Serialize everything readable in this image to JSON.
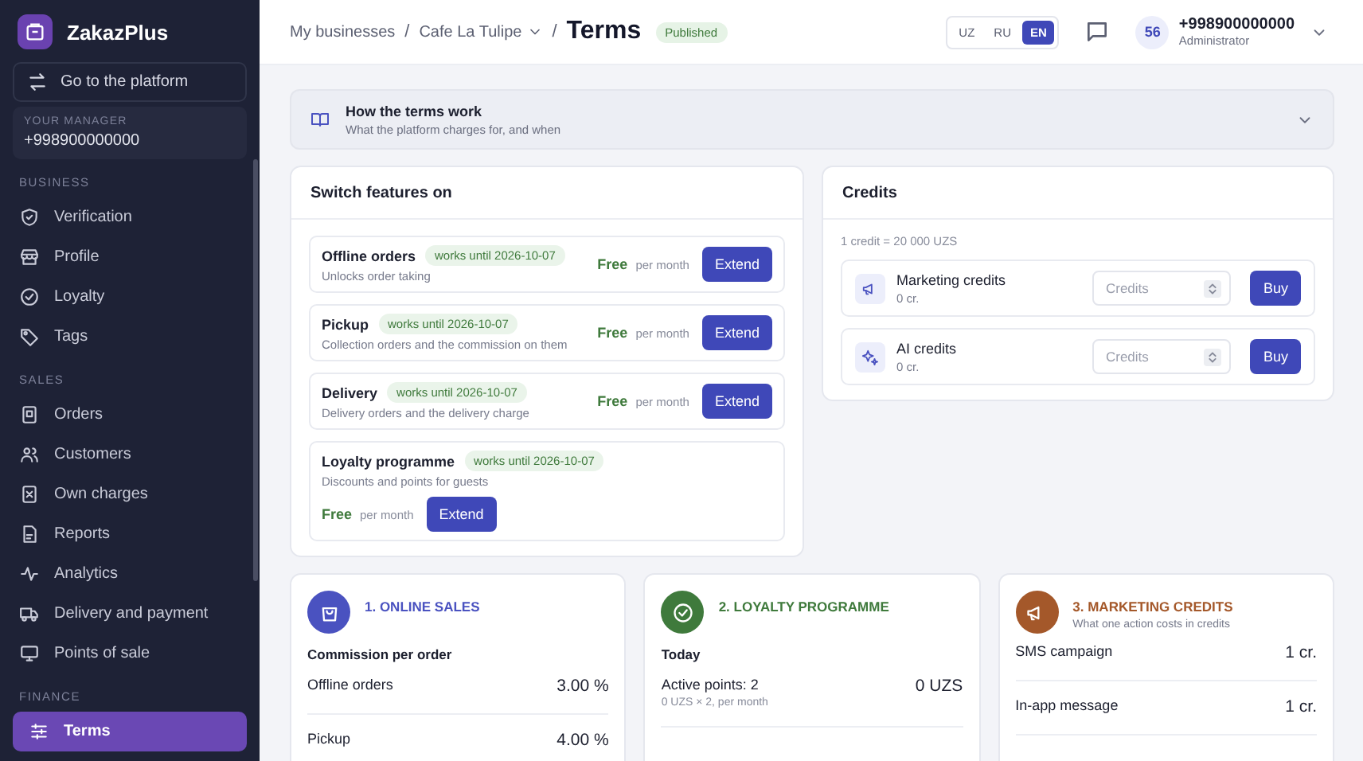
{
  "sidebar": {
    "brand": "ZakazPlus",
    "platform_link": "Go to the platform",
    "manager": {
      "label": "YOUR MANAGER",
      "phone": "+998900000000"
    },
    "sections": [
      {
        "title": "BUSINESS",
        "items": [
          {
            "label": "Verification",
            "selected": false
          },
          {
            "label": "Profile",
            "selected": false
          },
          {
            "label": "Loyalty",
            "selected": false
          },
          {
            "label": "Tags",
            "selected": false
          }
        ]
      },
      {
        "title": "SALES",
        "items": [
          {
            "label": "Orders",
            "selected": false
          },
          {
            "label": "Customers",
            "selected": false
          },
          {
            "label": "Own charges",
            "selected": false
          },
          {
            "label": "Reports",
            "selected": false
          },
          {
            "label": "Analytics",
            "selected": false
          },
          {
            "label": "Delivery and payment",
            "selected": false
          },
          {
            "label": "Points of sale",
            "selected": false
          }
        ]
      },
      {
        "title": "FINANCE",
        "items": [
          {
            "label": "Terms",
            "selected": true
          }
        ]
      }
    ]
  },
  "header": {
    "breadcrumbs": [
      "My businesses",
      "Cafe La Tulipe"
    ],
    "separator": "/",
    "title": "Terms",
    "status": "Published",
    "languages": [
      {
        "label": "UZ",
        "selected": false
      },
      {
        "label": "RU",
        "selected": false
      },
      {
        "label": "EN",
        "selected": true
      }
    ],
    "user": {
      "avatar": "56",
      "phone": "+998900000000",
      "role": "Administrator"
    }
  },
  "info": {
    "title": "How the terms work",
    "subtitle": "What the platform charges for, and when",
    "expanded": false
  },
  "features": {
    "title": "Switch features on",
    "items": [
      {
        "kind": "inline",
        "name": "Offline orders",
        "until": "works until 2026-10-07",
        "description": "Unlocks order taking",
        "price": "Free",
        "period": "per month",
        "button": "Extend"
      },
      {
        "kind": "inline",
        "name": "Pickup",
        "until": "works until 2026-10-07",
        "description": "Collection orders and the commission on them",
        "price": "Free",
        "period": "per month",
        "button": "Extend"
      },
      {
        "kind": "inline",
        "name": "Delivery",
        "until": "works until 2026-10-07",
        "description": "Delivery orders and the delivery charge",
        "price": "Free",
        "period": "per month",
        "button": "Extend"
      },
      {
        "kind": "stacked",
        "name": "Loyalty programme",
        "until": "works until 2026-10-07",
        "description": "Discounts and points for guests",
        "price": "Free",
        "period": "per month",
        "button": "Extend"
      }
    ]
  },
  "credits": {
    "title": "Credits",
    "rate": "1 credit = 20 000 UZS",
    "items": [
      {
        "name": "Marketing credits",
        "balance": "0 cr.",
        "placeholder": "Credits",
        "button": "Buy"
      },
      {
        "name": "AI credits",
        "balance": "0 cr.",
        "placeholder": "Credits",
        "button": "Buy"
      }
    ]
  },
  "sections": [
    {
      "title": "1. ONLINE SALES",
      "color": "#4a52c0",
      "heading": "Commission per order",
      "rows": [
        {
          "label": "Offline orders",
          "value": "3.00 %"
        },
        {
          "label": "Pickup",
          "value": "4.00 %"
        }
      ]
    },
    {
      "title": "2. LOYALTY PROGRAMME",
      "color": "#3f7a3c",
      "heading": "Today",
      "rows": [
        {
          "label": "Active points: 2",
          "note": "0 UZS × 2, per month",
          "value": "0 UZS"
        }
      ]
    },
    {
      "title": "3. MARKETING CREDITS",
      "color": "#a4582a",
      "subtitle": "What one action costs in credits",
      "rows": [
        {
          "label": "SMS campaign",
          "value": "1 cr."
        },
        {
          "label": "In-app message",
          "value": "1 cr."
        }
      ]
    }
  ]
}
